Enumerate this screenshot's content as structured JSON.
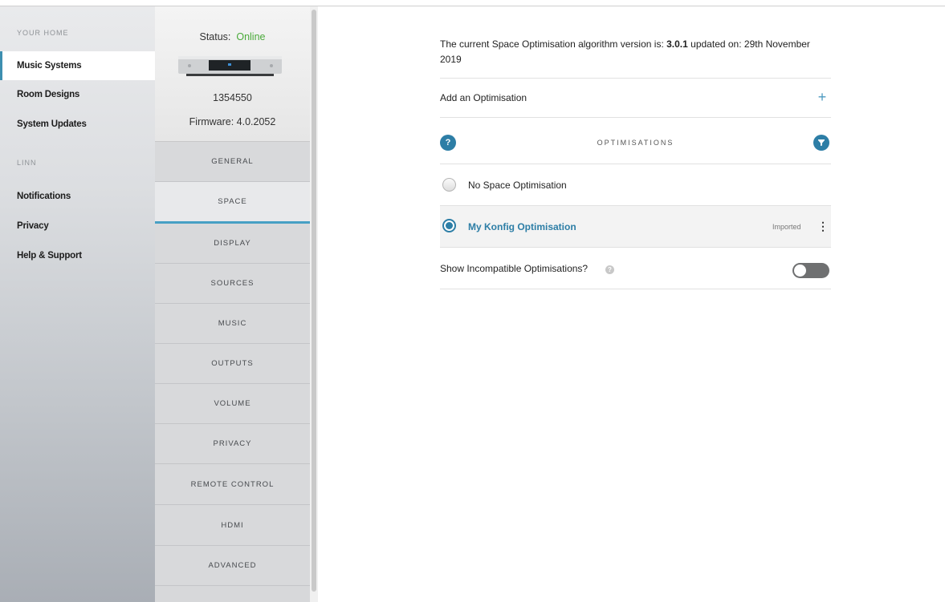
{
  "nav": {
    "section_home": "YOUR HOME",
    "items_home": [
      {
        "label": "Music Systems",
        "active": true
      },
      {
        "label": "Room Designs"
      },
      {
        "label": "System Updates"
      }
    ],
    "section_linn": "LINN",
    "items_linn": [
      {
        "label": "Notifications"
      },
      {
        "label": "Privacy"
      },
      {
        "label": "Help & Support"
      }
    ]
  },
  "device": {
    "status_label": "Status:",
    "status_value": "Online",
    "status_color": "#4aaa3a",
    "serial": "1354550",
    "firmware": "Firmware: 4.0.2052",
    "tabs": [
      {
        "label": "GENERAL"
      },
      {
        "label": "SPACE",
        "active": true
      },
      {
        "label": "DISPLAY"
      },
      {
        "label": "SOURCES"
      },
      {
        "label": "MUSIC"
      },
      {
        "label": "OUTPUTS"
      },
      {
        "label": "VOLUME"
      },
      {
        "label": "PRIVACY"
      },
      {
        "label": "REMOTE CONTROL"
      },
      {
        "label": "HDMI"
      },
      {
        "label": "ADVANCED"
      }
    ]
  },
  "content": {
    "version_prefix": "The current Space Optimisation algorithm version is: ",
    "version_number": "3.0.1",
    "version_suffix": " updated on: 29th November 2019",
    "add_label": "Add an Optimisation",
    "plus_glyph": "+",
    "help_glyph": "?",
    "optimisations_header": "OPTIMISATIONS",
    "options": [
      {
        "name": "No Space Optimisation",
        "selected": false
      },
      {
        "name": "My Konfig Optimisation",
        "selected": true,
        "tag": "Imported"
      }
    ],
    "kebab_glyph": "⋮",
    "info_glyph": "?",
    "show_incompatible_label": "Show Incompatible Optimisations?",
    "show_incompatible_on": false,
    "accent_color": "#2d7ea6"
  }
}
